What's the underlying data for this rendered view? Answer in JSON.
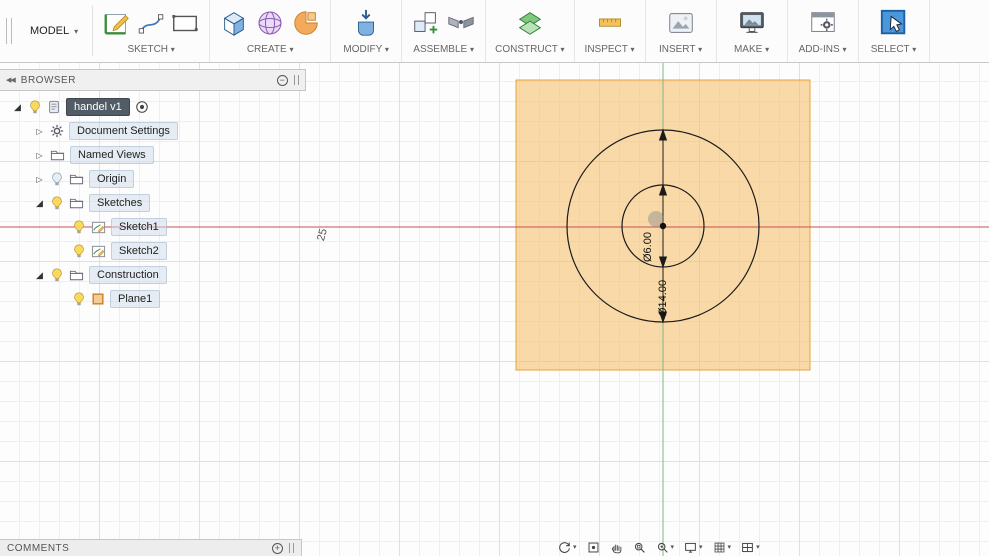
{
  "app": {
    "workspace_label": "MODEL"
  },
  "toolbar": {
    "groups": [
      {
        "label": "SKETCH",
        "icons": [
          "create-sketch",
          "spline",
          "rectangle"
        ]
      },
      {
        "label": "CREATE",
        "icons": [
          "box",
          "sphere",
          "form"
        ]
      },
      {
        "label": "MODIFY",
        "icons": [
          "press-pull"
        ]
      },
      {
        "label": "ASSEMBLE",
        "icons": [
          "new-component",
          "joint"
        ]
      },
      {
        "label": "CONSTRUCT",
        "icons": [
          "construction-plane"
        ]
      },
      {
        "label": "INSPECT",
        "icons": [
          "measure"
        ]
      },
      {
        "label": "INSERT",
        "icons": [
          "insert-image"
        ]
      },
      {
        "label": "MAKE",
        "icons": [
          "make"
        ]
      },
      {
        "label": "ADD-INS",
        "icons": [
          "addins"
        ]
      },
      {
        "label": "SELECT",
        "icons": [
          "select"
        ]
      }
    ]
  },
  "browser": {
    "title": "BROWSER",
    "items": [
      {
        "label": "handel v1",
        "icon": "document",
        "expander": "open",
        "bulb": "on",
        "indent": 0,
        "selected": true,
        "ground": true
      },
      {
        "label": "Document Settings",
        "icon": "gear",
        "expander": "closed",
        "bulb": null,
        "indent": 1
      },
      {
        "label": "Named Views",
        "icon": "folder",
        "expander": "closed",
        "bulb": null,
        "indent": 1
      },
      {
        "label": "Origin",
        "icon": "folder",
        "expander": "closed",
        "bulb": "off",
        "indent": 1
      },
      {
        "label": "Sketches",
        "icon": "folder",
        "expander": "open",
        "bulb": "on",
        "indent": 1
      },
      {
        "label": "Sketch1",
        "icon": "sketch",
        "expander": null,
        "bulb": "on",
        "indent": 2
      },
      {
        "label": "Sketch2",
        "icon": "sketch",
        "expander": null,
        "bulb": "on",
        "indent": 2
      },
      {
        "label": "Construction",
        "icon": "folder",
        "expander": "open",
        "bulb": "on",
        "indent": 1
      },
      {
        "label": "Plane1",
        "icon": "plane",
        "expander": null,
        "bulb": "on",
        "indent": 2
      }
    ]
  },
  "canvas": {
    "dim_inner": "Ø6.00",
    "dim_outer": "Ø14.00",
    "ruler_label": "25"
  },
  "comments": {
    "title": "COMMENTS"
  },
  "navbar": {
    "items": [
      {
        "icon": "orbit",
        "caret": true
      },
      {
        "icon": "look-at",
        "caret": false
      },
      {
        "icon": "pan",
        "caret": false
      },
      {
        "icon": "zoom-window",
        "caret": false
      },
      {
        "icon": "zoom",
        "caret": true
      },
      {
        "icon": "display-settings",
        "caret": true
      },
      {
        "icon": "grid-settings",
        "caret": true
      },
      {
        "icon": "viewports",
        "caret": true
      }
    ]
  },
  "colors": {
    "plane_fill": "#f6bc60",
    "plane_edge": "#e5a43c",
    "axis_x": "#c85050",
    "axis_y": "#7fb87f",
    "select_blue": "#4a97dc"
  }
}
